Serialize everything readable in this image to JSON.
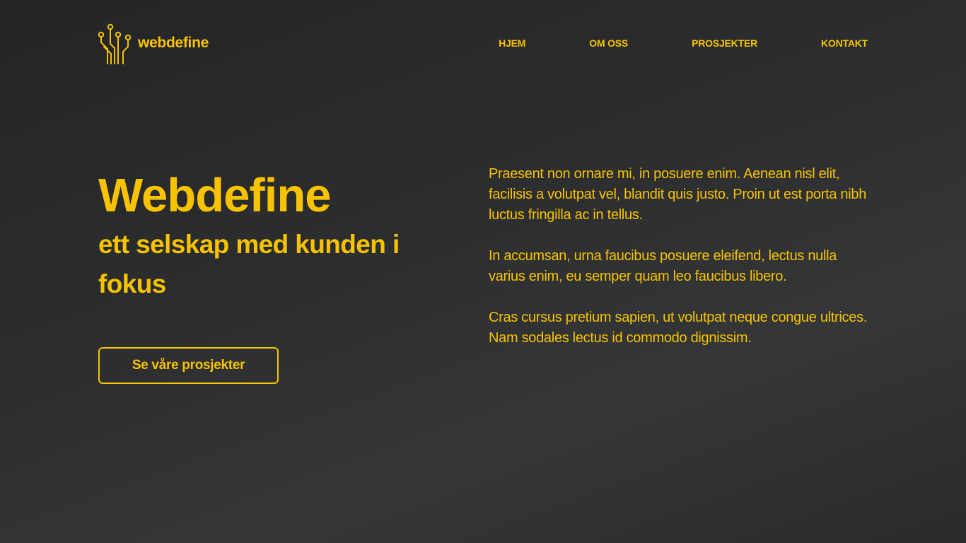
{
  "brand": {
    "name": "webdefine",
    "logo_icon": "circuit-icon",
    "accent_color": "#f7c300",
    "background_color": "#2d2e30"
  },
  "nav": {
    "items": [
      {
        "label": "HJEM"
      },
      {
        "label": "OM OSS"
      },
      {
        "label": "PROSJEKTER"
      },
      {
        "label": "KONTAKT"
      }
    ]
  },
  "hero": {
    "title": "Webdefine",
    "subtitle": "ett selskap med kunden i fokus",
    "cta_label": "Se våre prosjekter"
  },
  "intro": {
    "paragraphs": [
      "Praesent non ornare mi, in posuere enim. Aenean nisl elit, facilisis a volutpat vel, blandit quis justo. Proin ut est porta nibh luctus fringilla ac in tellus.",
      "In accumsan, urna faucibus posuere eleifend, lectus nulla varius enim, eu semper quam leo faucibus libero.",
      "Cras cursus pretium sapien, ut volutpat neque congue ultrices. Nam sodales lectus id commodo dignissim."
    ]
  }
}
